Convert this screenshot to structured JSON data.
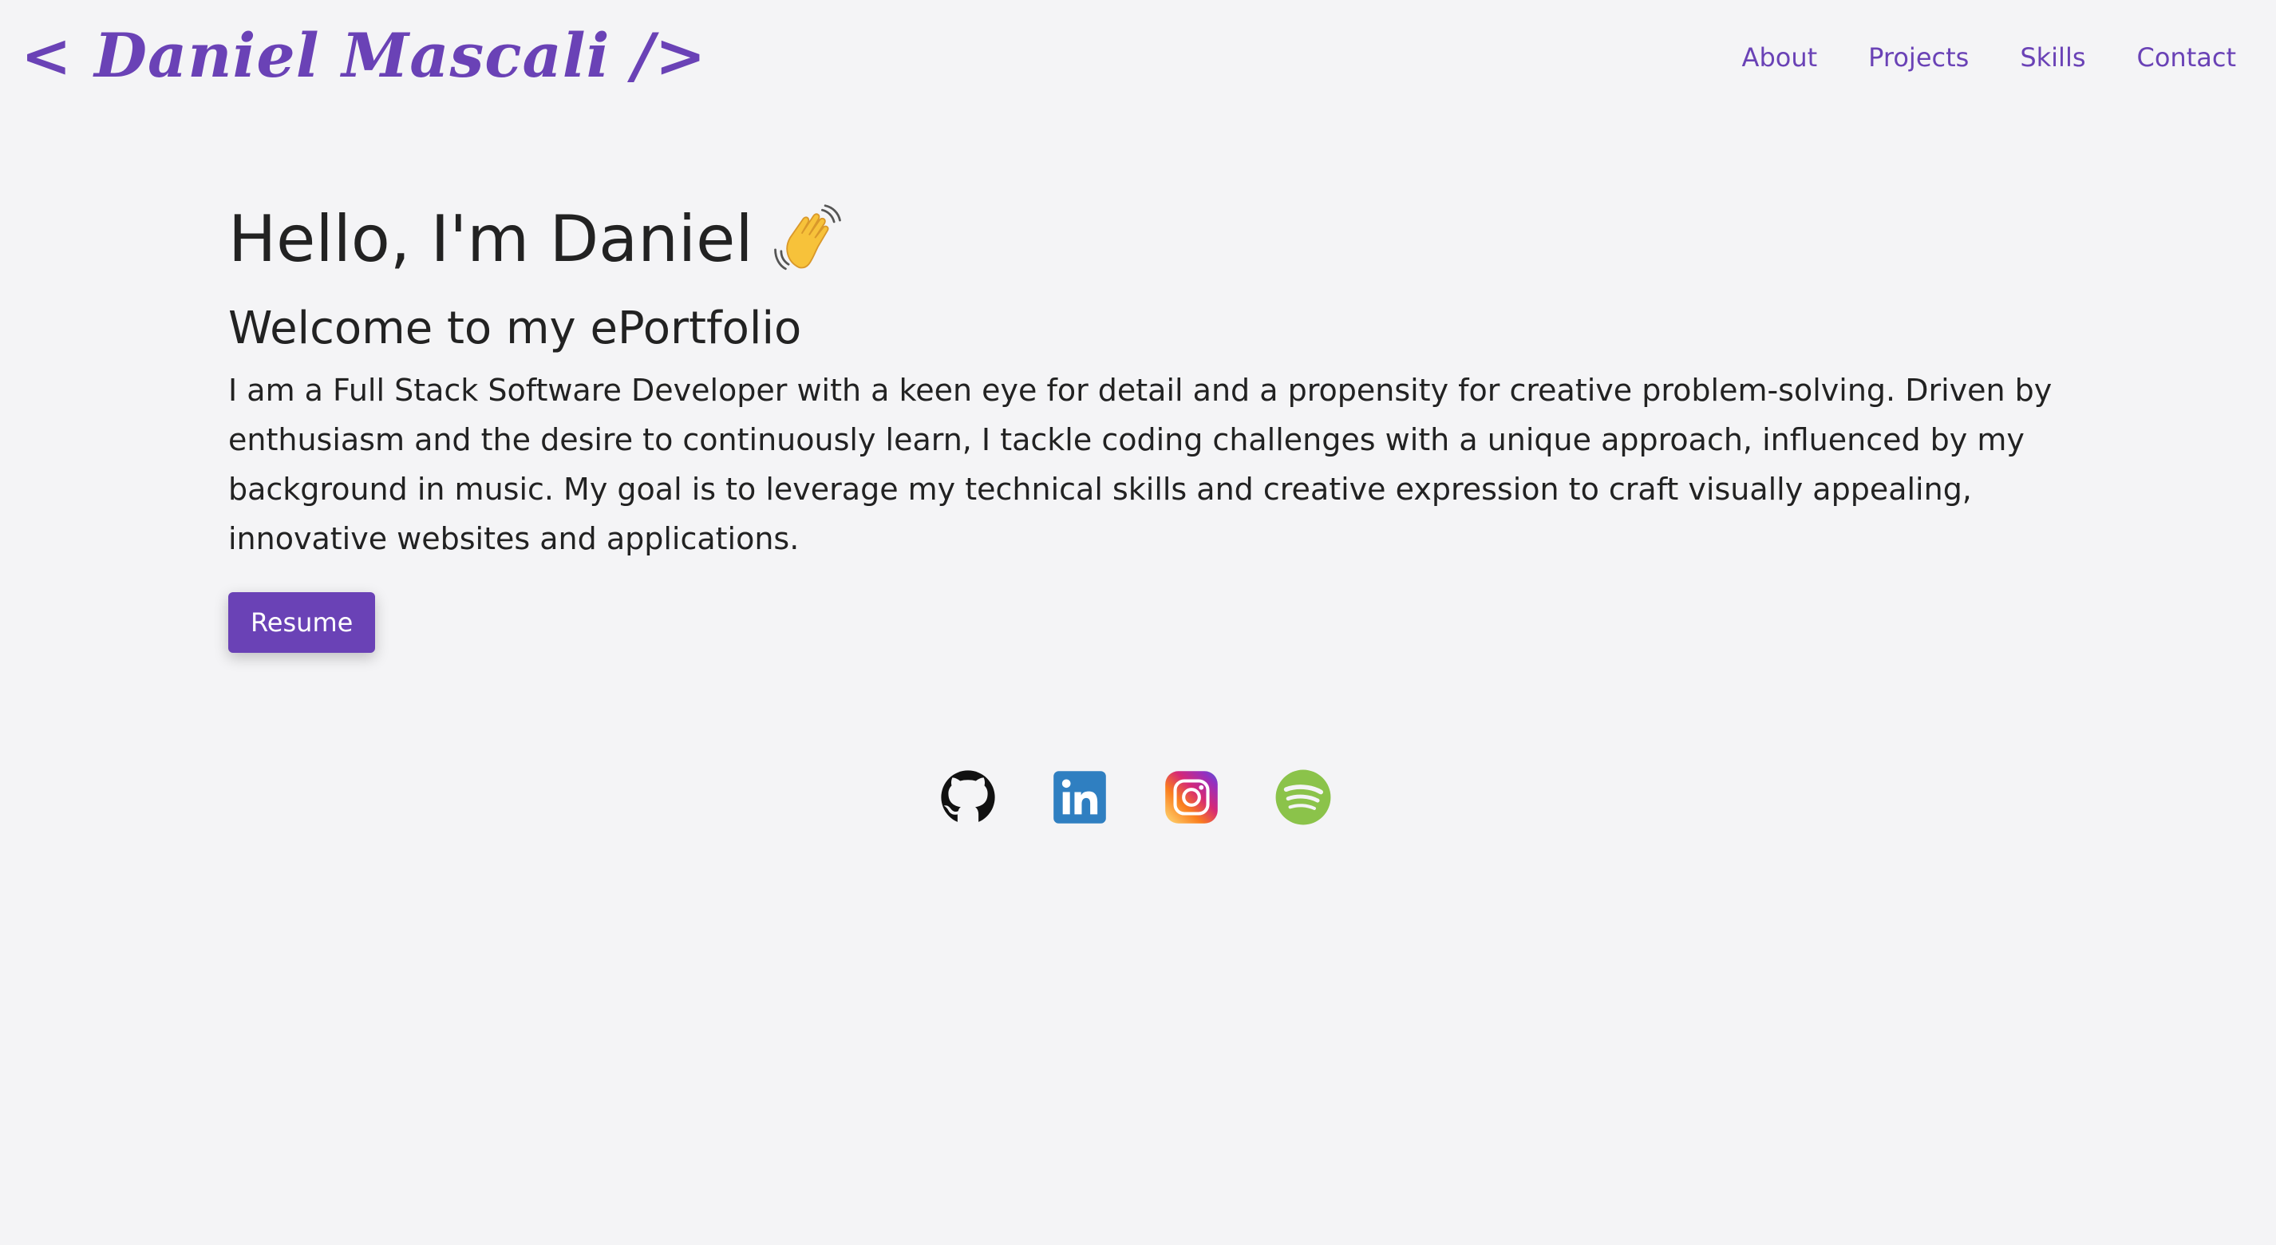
{
  "header": {
    "logo_text": "< Daniel Mascali />",
    "nav": [
      "About",
      "Projects",
      "Skills",
      "Contact"
    ]
  },
  "hero": {
    "greeting": "Hello, I'm Daniel",
    "emoji": "waving-hand-icon",
    "subtitle": "Welcome to my ePortfolio",
    "bio": "I am a Full Stack Software Developer with a keen eye for detail and a propensity for creative problem-solving. Driven by enthusiasm and the desire to continuously learn, I tackle coding challenges with a unique approach, influenced by my background in music. My goal is to leverage my technical skills and creative expression to craft visually appealing, innovative websites and applications.",
    "resume_label": "Resume"
  },
  "socials": [
    {
      "icon": "github-icon"
    },
    {
      "icon": "linkedin-icon"
    },
    {
      "icon": "instagram-icon"
    },
    {
      "icon": "spotify-icon"
    }
  ],
  "colors": {
    "accent": "#6a42b6",
    "background": "#f4f4f6",
    "text": "#222222",
    "linkedin": "#2f7fc1",
    "spotify": "#8bc34a"
  }
}
